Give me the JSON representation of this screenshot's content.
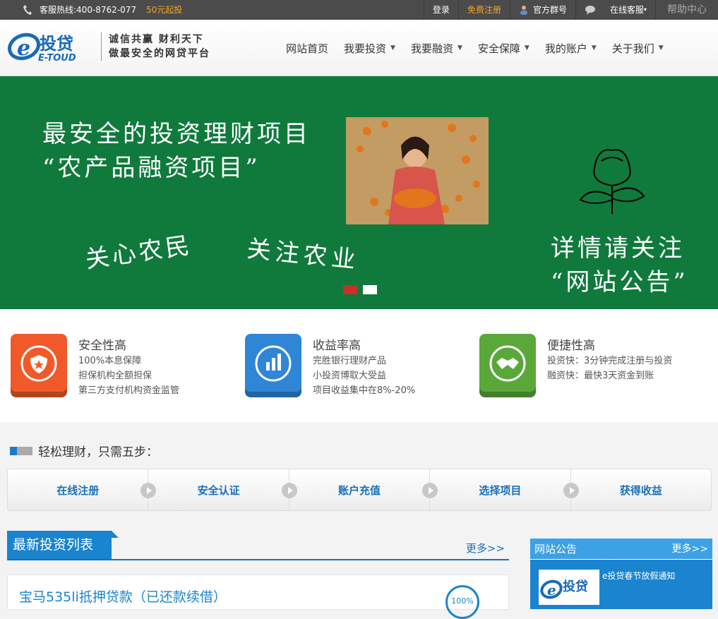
{
  "topbar": {
    "hotline": "客服热线:400-8762-077",
    "promo": "50元起投",
    "login": "登录",
    "register": "免费注册",
    "group": "官方群号",
    "online_service": "在线客服",
    "help_center": "帮助中心"
  },
  "header": {
    "logo_text": "投贷",
    "logo_sub": "E-TOUD",
    "slogan_line1": "诚信共赢  财利天下",
    "slogan_line2": "做最安全的网贷平台"
  },
  "nav": {
    "items": [
      {
        "label": "网站首页",
        "dropdown": false
      },
      {
        "label": "我要投资",
        "dropdown": true
      },
      {
        "label": "我要融资",
        "dropdown": true
      },
      {
        "label": "安全保障",
        "dropdown": true
      },
      {
        "label": "我的账户",
        "dropdown": true
      },
      {
        "label": "关于我们",
        "dropdown": true
      }
    ]
  },
  "banner": {
    "title_line1": "最安全的投资理财项目",
    "title_line2": "“农产品融资项目”",
    "left_text": "关心农民",
    "mid_text": "关注农业",
    "right_line1": "详情请关注",
    "right_line2": "“网站公告”",
    "background": "#0f7a3c"
  },
  "features": [
    {
      "title": "安全性高",
      "lines": [
        "100%本息保障",
        "担保机构全额担保",
        "第三方支付机构资金监管"
      ],
      "color": "#f05a2a",
      "icon": "shield-icon"
    },
    {
      "title": "收益率高",
      "lines": [
        "完胜银行理财产品",
        "小投资博取大受益",
        "项目收益集中在8%-20%"
      ],
      "color": "#2f86d6",
      "icon": "bar-chart-icon"
    },
    {
      "title": "便捷性高",
      "lines": [
        "投资快：3分钟完成注册与投资",
        "融资快：最快3天资金到账"
      ],
      "color": "#5aa83a",
      "icon": "handshake-icon"
    }
  ],
  "steps": {
    "title": "轻松理财，只需五步：",
    "items": [
      "在线注册",
      "安全认证",
      "账户充值",
      "选择项目",
      "获得收益"
    ]
  },
  "list": {
    "title": "最新投资列表",
    "more": "更多>>",
    "items": [
      {
        "title": "宝马535li抵押贷款（已还款续借）",
        "progress": "100%"
      }
    ]
  },
  "notice": {
    "title": "网站公告",
    "more": "更多>>",
    "items": [
      {
        "text": "e投贷春节放假通知"
      }
    ]
  }
}
